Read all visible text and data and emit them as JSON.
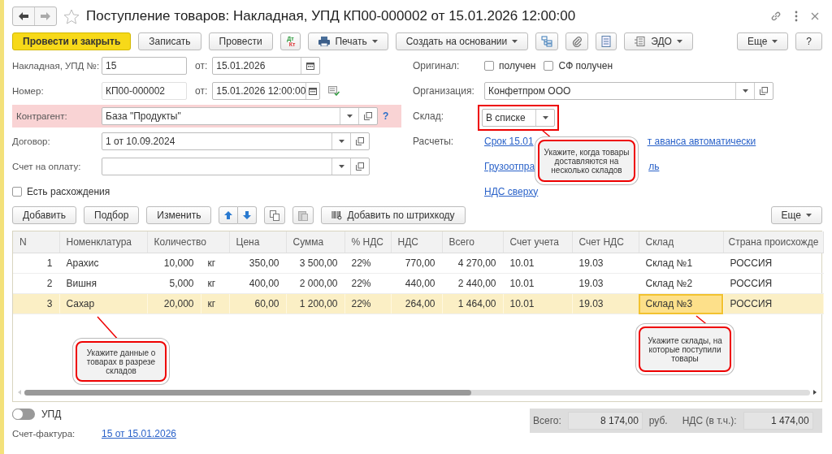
{
  "window": {
    "title": "Поступление товаров: Накладная, УПД КП00-000002 от 15.01.2026 12:00:00"
  },
  "toolbar": [
    {
      "kind": "primary",
      "label": "Провести и закрыть"
    },
    {
      "kind": "plain",
      "label": "Записать"
    },
    {
      "kind": "plain",
      "label": "Провести"
    },
    {
      "kind": "dtkt",
      "top": "Дт",
      "bottom": "Кт"
    },
    {
      "kind": "print",
      "label": "Печать"
    },
    {
      "kind": "menu",
      "label": "Создать на основании"
    },
    {
      "kind": "structure"
    },
    {
      "kind": "attach"
    },
    {
      "kind": "list"
    },
    {
      "kind": "edo",
      "label": "ЭДО"
    }
  ],
  "toolbar_right": [
    {
      "kind": "menu",
      "label": "Еще"
    },
    {
      "kind": "plain",
      "label": "?"
    }
  ],
  "form_left": [
    {
      "kind": "numdate",
      "label": "Накладная, УПД №:",
      "value": "15",
      "readonly": false,
      "date_label": "от:",
      "date": "15.01.2026"
    },
    {
      "kind": "numdate",
      "label": "Номер:",
      "value": "КП00-000002",
      "readonly": true,
      "date_label": "от:",
      "date": "15.01.2026 12:00:00",
      "status_icon": true
    },
    {
      "kind": "ref",
      "label": "Контрагент:",
      "value": "База \"Продукты\"",
      "highlighted": true,
      "help": "?"
    },
    {
      "kind": "ref",
      "label": "Договор:",
      "value": "1 от 10.09.2024"
    },
    {
      "kind": "ref",
      "label": "Счет на оплату:"
    },
    {
      "kind": "check",
      "label": "Есть расхождения",
      "checked": false
    }
  ],
  "form_right": [
    {
      "kind": "checks",
      "label": "Оригинал:",
      "options": [
        {
          "label": "получен",
          "checked": false
        },
        {
          "label": "СФ получен",
          "checked": false
        }
      ]
    },
    {
      "kind": "ref",
      "label": "Организация:",
      "value": "Конфетпром ООО"
    },
    {
      "kind": "select",
      "label": "Склад:",
      "value": "В списке",
      "framed": true
    },
    {
      "kind": "links",
      "label": "Расчеты:",
      "parts": [
        "Срок 15.01",
        "т аванса автоматически"
      ]
    },
    {
      "kind": "links",
      "parts": [
        "Грузоотпра",
        "ль"
      ]
    },
    {
      "kind": "links",
      "parts": [
        "НДС сверху"
      ]
    }
  ],
  "table_toolbar": [
    {
      "kind": "plain",
      "label": "Добавить"
    },
    {
      "kind": "plain",
      "label": "Подбор"
    },
    {
      "kind": "plain",
      "label": "Изменить"
    },
    {
      "kind": "updown"
    },
    {
      "kind": "copy"
    },
    {
      "kind": "paste"
    },
    {
      "kind": "barcode",
      "label": "Добавить по штрихкоду"
    }
  ],
  "table_toolbar_right": [
    {
      "kind": "menu",
      "label": "Еще"
    }
  ],
  "table": {
    "columns": [
      "N",
      "Номенклатура",
      "Количество",
      "Цена",
      "Сумма",
      "% НДС",
      "НДС",
      "Всего",
      "Счет учета",
      "Счет НДС",
      "Склад",
      "Страна происхожде"
    ],
    "rows": [
      {
        "n": "1",
        "name": "Арахис",
        "qty": "10,000",
        "unit": "кг",
        "price": "350,00",
        "sum": "3 500,00",
        "vat_rate": "22%",
        "vat": "770,00",
        "total": "4 270,00",
        "account": "10.01",
        "vat_account": "19.03",
        "warehouse": "Склад №1",
        "country": "РОССИЯ",
        "selected": false,
        "warehouse_focused": false
      },
      {
        "n": "2",
        "name": "Вишня",
        "qty": "5,000",
        "unit": "кг",
        "price": "400,00",
        "sum": "2 000,00",
        "vat_rate": "22%",
        "vat": "440,00",
        "total": "2 440,00",
        "account": "10.01",
        "vat_account": "19.03",
        "warehouse": "Склад №2",
        "country": "РОССИЯ",
        "selected": false,
        "warehouse_focused": false
      },
      {
        "n": "3",
        "name": "Сахар",
        "qty": "20,000",
        "unit": "кг",
        "price": "60,00",
        "sum": "1 200,00",
        "vat_rate": "22%",
        "vat": "264,00",
        "total": "1 464,00",
        "account": "10.01",
        "vat_account": "19.03",
        "warehouse": "Склад №3",
        "country": "РОССИЯ",
        "selected": true,
        "warehouse_focused": true
      }
    ]
  },
  "footer": {
    "upd": {
      "label": "УПД",
      "on": false
    },
    "invoice": {
      "label": "Счет-фактура:",
      "link": "15 от 15.01.2026"
    },
    "totals": {
      "total_label": "Всего:",
      "total": "8 174,00",
      "currency": "руб.",
      "vat_label": "НДС (в т.ч.):",
      "vat": "1 474,00"
    }
  },
  "callouts": [
    "Укажите, когда товары доставляются на несколько складов",
    "Укажите данные о товарах в разрезе складов",
    "Укажите склады, на которые поступили товары"
  ]
}
